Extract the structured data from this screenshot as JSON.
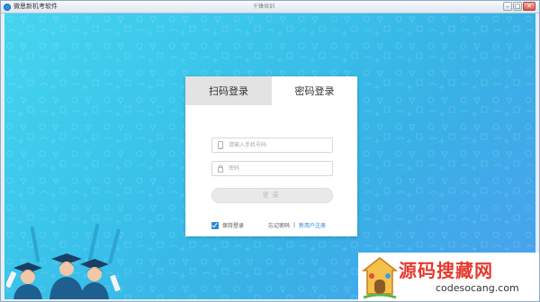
{
  "window": {
    "title": "微思新机考软件",
    "center_text": "千锋培训",
    "controls": {
      "minimize": "–",
      "maximize": "□",
      "close": "✕"
    }
  },
  "login": {
    "tabs": [
      {
        "label": "扫码登录",
        "active": false
      },
      {
        "label": "密码登录",
        "active": true
      }
    ],
    "phone": {
      "placeholder": "请输入手机号码",
      "value": "",
      "icon": "phone-icon"
    },
    "password": {
      "placeholder": "密码",
      "value": "",
      "icon": "lock-icon"
    },
    "submit_label": "登录",
    "remember": {
      "label": "保持登录",
      "checked": true
    },
    "forgot_label": "忘记密码",
    "separator": "|",
    "register_label": "新用户注册"
  },
  "watermark": {
    "title": "源码搜藏网",
    "subtitle": "codesocang.com"
  },
  "colors": {
    "background_start": "#45d5ef",
    "background_end": "#4aa0ee",
    "accent": "#2f86d6",
    "watermark_red": "#e53a2e"
  }
}
